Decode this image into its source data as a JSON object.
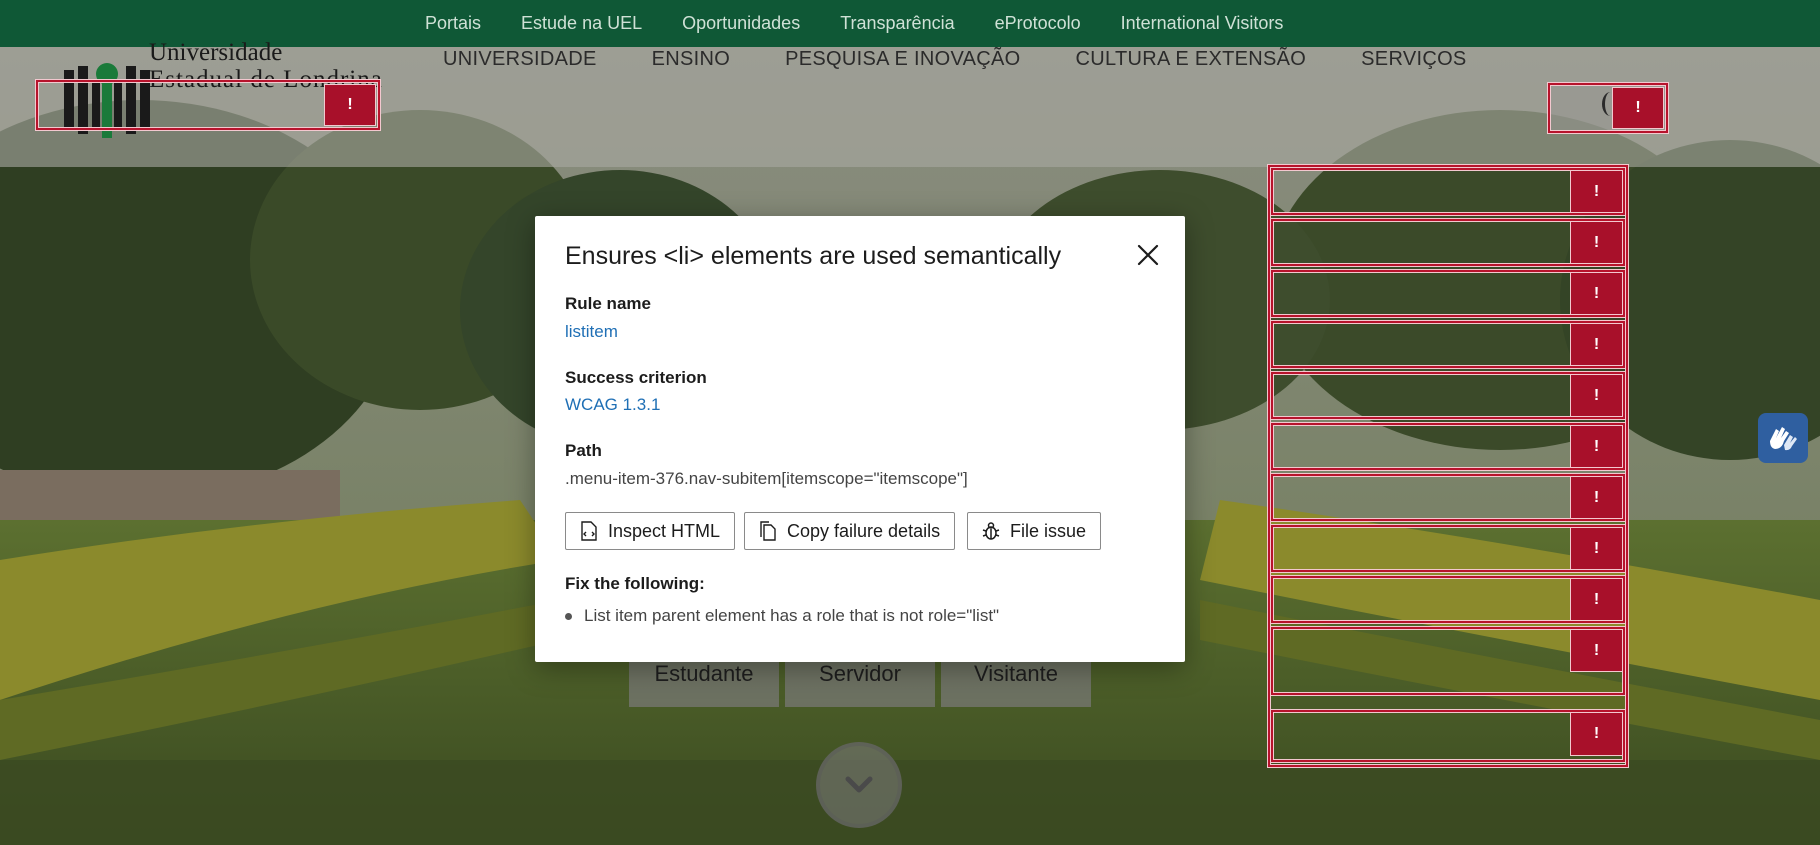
{
  "topbar": {
    "links": [
      "Portais",
      "Estude na UEL",
      "Oportunidades",
      "Transparência",
      "eProtocolo",
      "International Visitors"
    ]
  },
  "header": {
    "logo_line1": "Universidade",
    "logo_line2": "Estadual de Londrina",
    "nav": [
      "UNIVERSIDADE",
      "ENSINO",
      "PESQUISA E INOVAÇÃO",
      "CULTURA E EXTENSÃO",
      "SERVIÇOS"
    ]
  },
  "hero": {
    "buttons": [
      "Estudante",
      "Servidor",
      "Visitante"
    ]
  },
  "flag_symbol": "!",
  "modal": {
    "title": "Ensures <li> elements are used semantically",
    "rule_name_label": "Rule name",
    "rule_name": "listitem",
    "success_criterion_label": "Success criterion",
    "success_criterion": "WCAG 1.3.1",
    "path_label": "Path",
    "path": ".menu-item-376.nav-subitem[itemscope=\"itemscope\"]",
    "buttons": {
      "inspect": "Inspect HTML",
      "copy": "Copy failure details",
      "file": "File issue"
    },
    "fix_label": "Fix the following:",
    "fix_items": [
      "List item parent element has a role that is not role=\"list\""
    ]
  },
  "colors": {
    "topbar": "#0f5836",
    "failure": "#a8102a",
    "link": "#1f6fb5",
    "widget": "#2f5fa0"
  }
}
